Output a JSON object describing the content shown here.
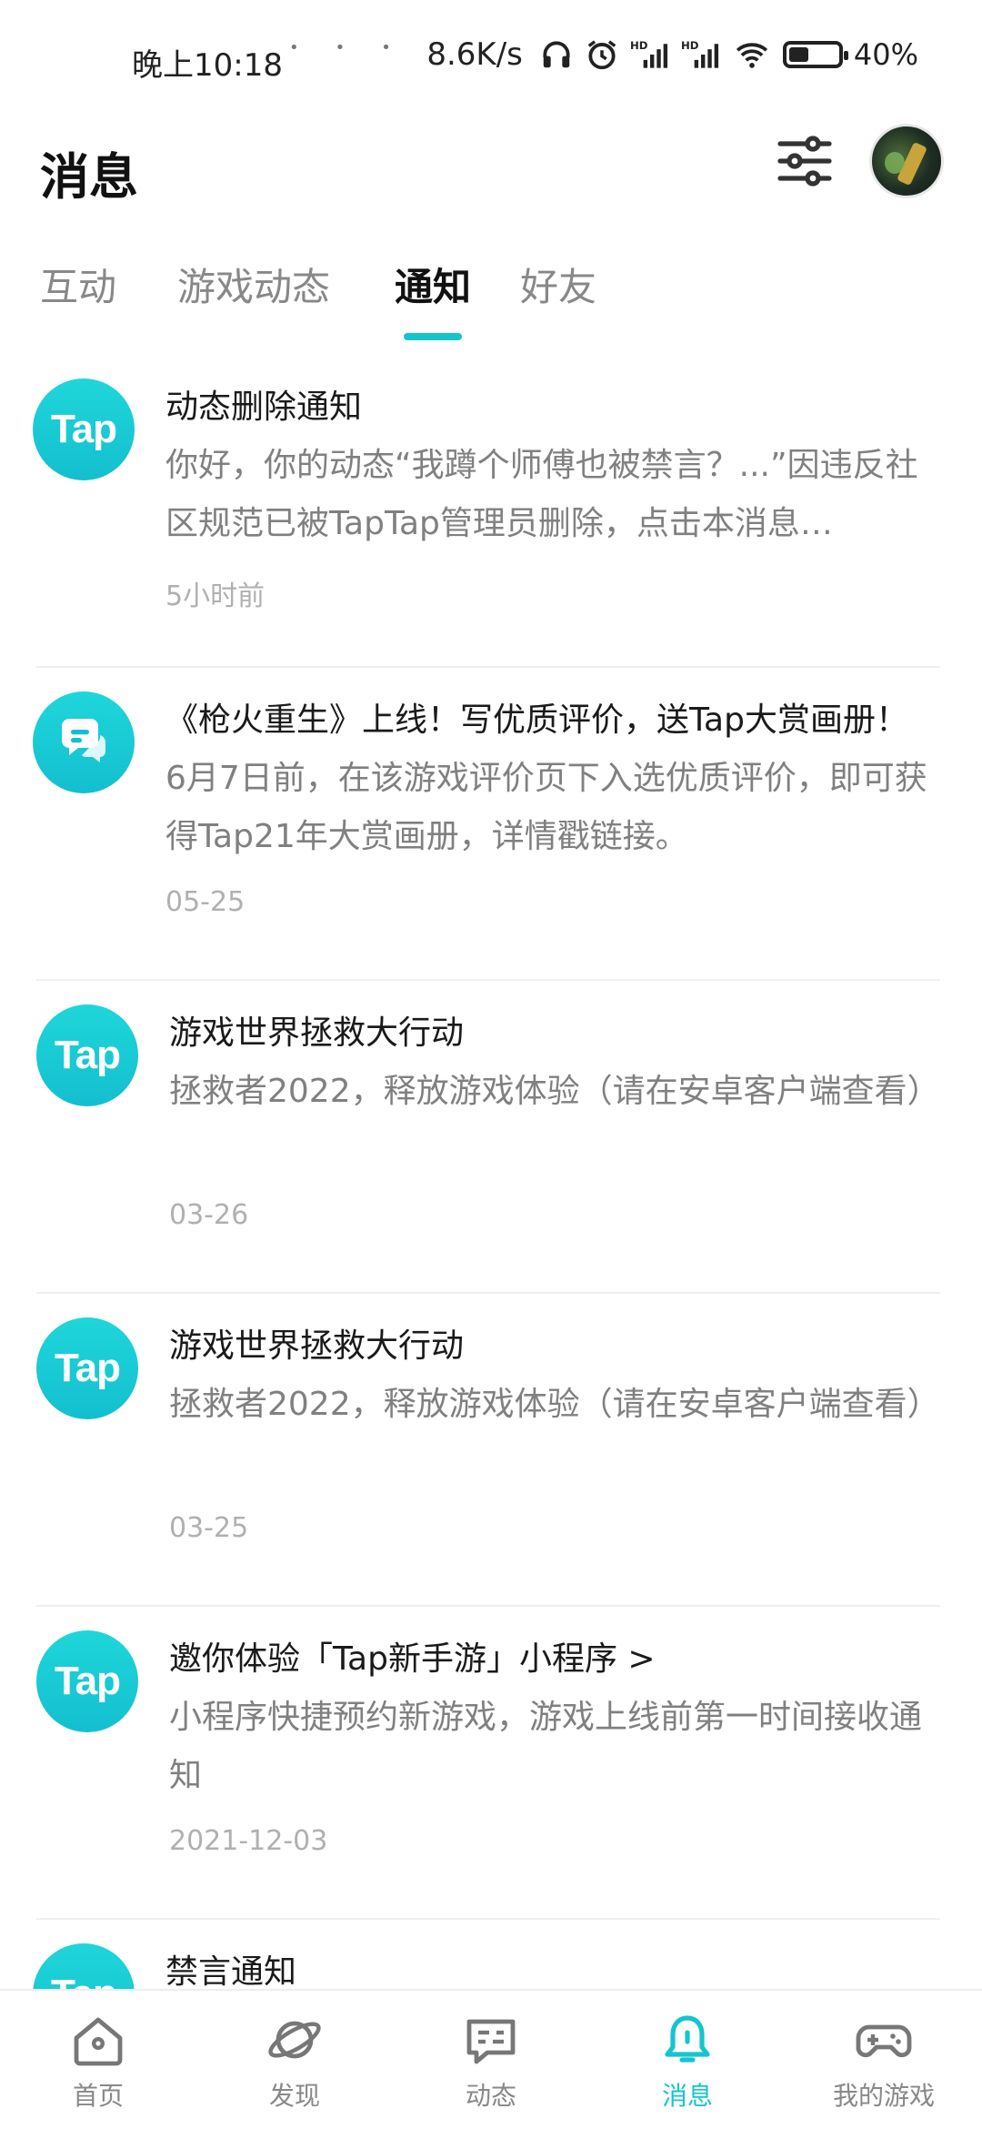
{
  "status_bar": {
    "time": "晚上10:18",
    "net_speed": "8.6K/s",
    "battery_text": "40%",
    "battery_level": 0.4,
    "icons": [
      "headset-icon",
      "alarm-icon",
      "hd-signal-icon",
      "hd-signal-icon",
      "wifi-icon",
      "battery-icon"
    ]
  },
  "header": {
    "title": "消息",
    "filter_icon": "sliders-icon",
    "avatar_icon": "avatar"
  },
  "tabs": [
    {
      "label": "互动",
      "active": false
    },
    {
      "label": "游戏动态",
      "active": false
    },
    {
      "label": "通知",
      "active": true
    },
    {
      "label": "好友",
      "active": false
    }
  ],
  "accent_color": "#15c5ce",
  "notifications": [
    {
      "logo": "Tap",
      "title": "动态删除通知",
      "body": "你好，你的动态“我蹲个师傅也被禁言？...”因违反社区规范已被TapTap管理员删除，点击本消息…",
      "time": "5小时前"
    },
    {
      "logo": "chat-bubble-icon",
      "title": "《枪火重生》上线！写优质评价，送Tap大赏画册！",
      "body": "6月7日前，在该游戏评价页下入选优质评价，即可获得Tap21年大赏画册，详情戳链接。",
      "time": "05-25"
    },
    {
      "logo": "Tap",
      "title": "游戏世界拯救大行动",
      "body": "拯救者2022，释放游戏体验（请在安卓客户端查看）",
      "time": "03-26"
    },
    {
      "logo": "Tap",
      "title": "游戏世界拯救大行动",
      "body": "拯救者2022，释放游戏体验（请在安卓客户端查看）",
      "time": "03-25"
    },
    {
      "logo": "Tap",
      "title": "邀你体验「Tap新手游」小程序 >",
      "body": "小程序快捷预约新游戏，游戏上线前第一时间接收通知",
      "time": "2021-12-03"
    },
    {
      "logo": "Tap",
      "title": "禁言通知",
      "body": "",
      "time": ""
    }
  ],
  "bottom_nav": [
    {
      "label": "首页",
      "icon": "home-icon",
      "active": false
    },
    {
      "label": "发现",
      "icon": "planet-icon",
      "active": false
    },
    {
      "label": "动态",
      "icon": "message-square-icon",
      "active": false
    },
    {
      "label": "消息",
      "icon": "bell-icon",
      "active": true
    },
    {
      "label": "我的游戏",
      "icon": "gamepad-icon",
      "active": false
    }
  ]
}
